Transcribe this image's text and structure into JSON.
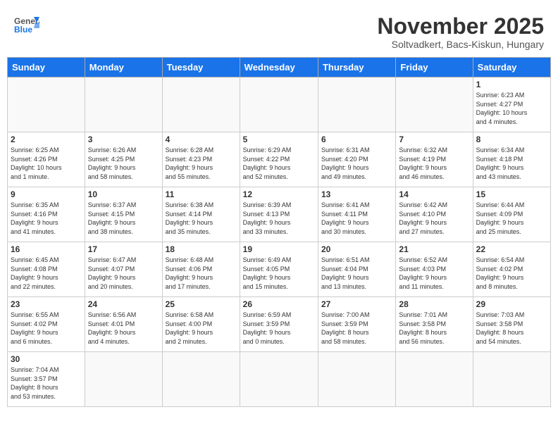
{
  "header": {
    "logo_general": "General",
    "logo_blue": "Blue",
    "month_title": "November 2025",
    "location": "Soltvadkert, Bacs-Kiskun, Hungary"
  },
  "weekdays": [
    "Sunday",
    "Monday",
    "Tuesday",
    "Wednesday",
    "Thursday",
    "Friday",
    "Saturday"
  ],
  "weeks": [
    [
      {
        "day": "",
        "info": ""
      },
      {
        "day": "",
        "info": ""
      },
      {
        "day": "",
        "info": ""
      },
      {
        "day": "",
        "info": ""
      },
      {
        "day": "",
        "info": ""
      },
      {
        "day": "",
        "info": ""
      },
      {
        "day": "1",
        "info": "Sunrise: 6:23 AM\nSunset: 4:27 PM\nDaylight: 10 hours\nand 4 minutes."
      }
    ],
    [
      {
        "day": "2",
        "info": "Sunrise: 6:25 AM\nSunset: 4:26 PM\nDaylight: 10 hours\nand 1 minute."
      },
      {
        "day": "3",
        "info": "Sunrise: 6:26 AM\nSunset: 4:25 PM\nDaylight: 9 hours\nand 58 minutes."
      },
      {
        "day": "4",
        "info": "Sunrise: 6:28 AM\nSunset: 4:23 PM\nDaylight: 9 hours\nand 55 minutes."
      },
      {
        "day": "5",
        "info": "Sunrise: 6:29 AM\nSunset: 4:22 PM\nDaylight: 9 hours\nand 52 minutes."
      },
      {
        "day": "6",
        "info": "Sunrise: 6:31 AM\nSunset: 4:20 PM\nDaylight: 9 hours\nand 49 minutes."
      },
      {
        "day": "7",
        "info": "Sunrise: 6:32 AM\nSunset: 4:19 PM\nDaylight: 9 hours\nand 46 minutes."
      },
      {
        "day": "8",
        "info": "Sunrise: 6:34 AM\nSunset: 4:18 PM\nDaylight: 9 hours\nand 43 minutes."
      }
    ],
    [
      {
        "day": "9",
        "info": "Sunrise: 6:35 AM\nSunset: 4:16 PM\nDaylight: 9 hours\nand 41 minutes."
      },
      {
        "day": "10",
        "info": "Sunrise: 6:37 AM\nSunset: 4:15 PM\nDaylight: 9 hours\nand 38 minutes."
      },
      {
        "day": "11",
        "info": "Sunrise: 6:38 AM\nSunset: 4:14 PM\nDaylight: 9 hours\nand 35 minutes."
      },
      {
        "day": "12",
        "info": "Sunrise: 6:39 AM\nSunset: 4:13 PM\nDaylight: 9 hours\nand 33 minutes."
      },
      {
        "day": "13",
        "info": "Sunrise: 6:41 AM\nSunset: 4:11 PM\nDaylight: 9 hours\nand 30 minutes."
      },
      {
        "day": "14",
        "info": "Sunrise: 6:42 AM\nSunset: 4:10 PM\nDaylight: 9 hours\nand 27 minutes."
      },
      {
        "day": "15",
        "info": "Sunrise: 6:44 AM\nSunset: 4:09 PM\nDaylight: 9 hours\nand 25 minutes."
      }
    ],
    [
      {
        "day": "16",
        "info": "Sunrise: 6:45 AM\nSunset: 4:08 PM\nDaylight: 9 hours\nand 22 minutes."
      },
      {
        "day": "17",
        "info": "Sunrise: 6:47 AM\nSunset: 4:07 PM\nDaylight: 9 hours\nand 20 minutes."
      },
      {
        "day": "18",
        "info": "Sunrise: 6:48 AM\nSunset: 4:06 PM\nDaylight: 9 hours\nand 17 minutes."
      },
      {
        "day": "19",
        "info": "Sunrise: 6:49 AM\nSunset: 4:05 PM\nDaylight: 9 hours\nand 15 minutes."
      },
      {
        "day": "20",
        "info": "Sunrise: 6:51 AM\nSunset: 4:04 PM\nDaylight: 9 hours\nand 13 minutes."
      },
      {
        "day": "21",
        "info": "Sunrise: 6:52 AM\nSunset: 4:03 PM\nDaylight: 9 hours\nand 11 minutes."
      },
      {
        "day": "22",
        "info": "Sunrise: 6:54 AM\nSunset: 4:02 PM\nDaylight: 9 hours\nand 8 minutes."
      }
    ],
    [
      {
        "day": "23",
        "info": "Sunrise: 6:55 AM\nSunset: 4:02 PM\nDaylight: 9 hours\nand 6 minutes."
      },
      {
        "day": "24",
        "info": "Sunrise: 6:56 AM\nSunset: 4:01 PM\nDaylight: 9 hours\nand 4 minutes."
      },
      {
        "day": "25",
        "info": "Sunrise: 6:58 AM\nSunset: 4:00 PM\nDaylight: 9 hours\nand 2 minutes."
      },
      {
        "day": "26",
        "info": "Sunrise: 6:59 AM\nSunset: 3:59 PM\nDaylight: 9 hours\nand 0 minutes."
      },
      {
        "day": "27",
        "info": "Sunrise: 7:00 AM\nSunset: 3:59 PM\nDaylight: 8 hours\nand 58 minutes."
      },
      {
        "day": "28",
        "info": "Sunrise: 7:01 AM\nSunset: 3:58 PM\nDaylight: 8 hours\nand 56 minutes."
      },
      {
        "day": "29",
        "info": "Sunrise: 7:03 AM\nSunset: 3:58 PM\nDaylight: 8 hours\nand 54 minutes."
      }
    ],
    [
      {
        "day": "30",
        "info": "Sunrise: 7:04 AM\nSunset: 3:57 PM\nDaylight: 8 hours\nand 53 minutes."
      },
      {
        "day": "",
        "info": ""
      },
      {
        "day": "",
        "info": ""
      },
      {
        "day": "",
        "info": ""
      },
      {
        "day": "",
        "info": ""
      },
      {
        "day": "",
        "info": ""
      },
      {
        "day": "",
        "info": ""
      }
    ]
  ]
}
